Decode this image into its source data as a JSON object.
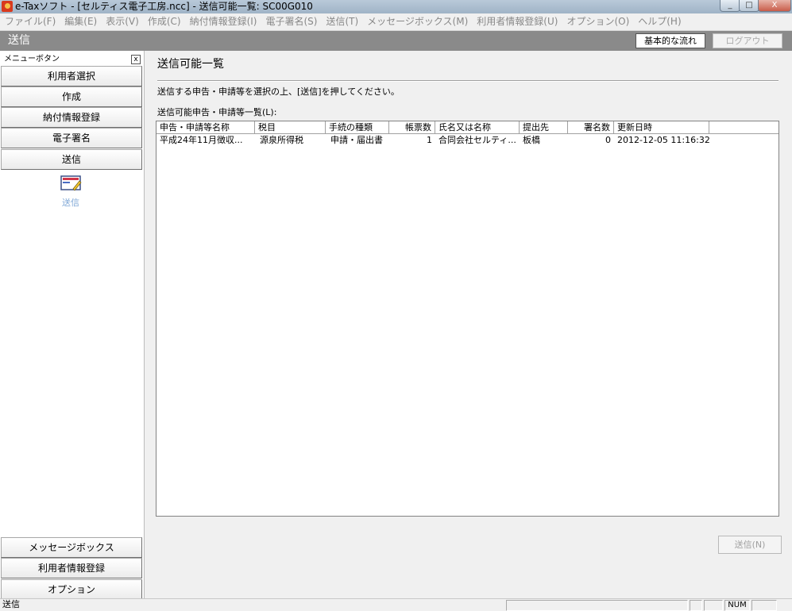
{
  "window": {
    "title": "e-Taxソフト - [セルティス電子工房.ncc] - 送信可能一覧: SC00G010",
    "minimize": "_",
    "maximize": "□",
    "close": "X"
  },
  "menu": [
    "ファイル(F)",
    "編集(E)",
    "表示(V)",
    "作成(C)",
    "納付情報登録(I)",
    "電子署名(S)",
    "送信(T)",
    "メッセージボックス(M)",
    "利用者情報登録(U)",
    "オプション(O)",
    "ヘルプ(H)"
  ],
  "header": {
    "title": "送信",
    "flow_button": "基本的な流れ",
    "logout_button": "ログアウト"
  },
  "sidebar": {
    "heading": "メニューボタン",
    "close_glyph": "x",
    "top_items": [
      "利用者選択",
      "作成",
      "納付情報登録",
      "電子署名",
      "送信"
    ],
    "selected_icon_label": "送信",
    "bottom_items": [
      "メッセージボックス",
      "利用者情報登録",
      "オプション"
    ]
  },
  "main": {
    "page_title": "送信可能一覧",
    "instruction": "送信する申告・申請等を選択の上、[送信]を押してください。",
    "list_label": "送信可能申告・申請等一覧(L):",
    "columns": [
      "申告・申請等名称",
      "税目",
      "手続の種類",
      "帳票数",
      "氏名又は名称",
      "提出先",
      "署名数",
      "更新日時"
    ],
    "rows": [
      [
        "平成24年11月徴収...",
        "源泉所得税",
        "申請・届出書",
        "1",
        "合同会社セルティ...",
        "板橋",
        "0",
        "2012-12-05 11:16:32"
      ]
    ],
    "send_button": "送信(N)"
  },
  "statusbar": {
    "text": "送信",
    "num_indicator": "NUM"
  }
}
